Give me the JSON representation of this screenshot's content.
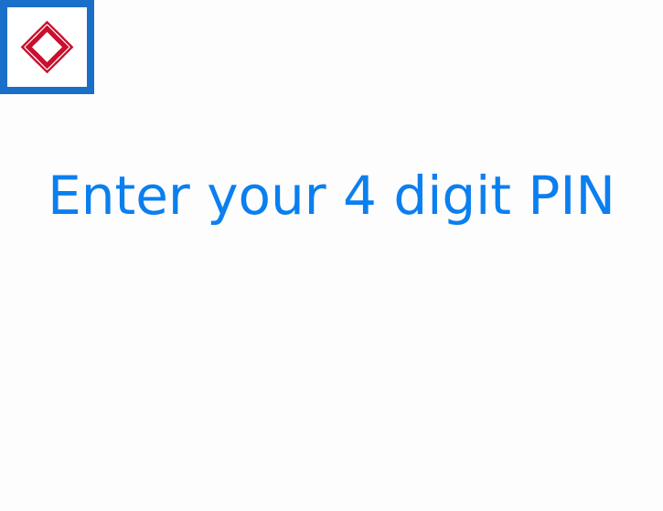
{
  "header": {
    "logo_icon": "bank-logo-icon",
    "brand_colors": {
      "logo_border": "#1a6fc8",
      "logo_mark": "#c8102e"
    }
  },
  "main": {
    "prompt_text": "Enter your 4 digit PIN",
    "prompt_color": "#0b7ff0"
  }
}
